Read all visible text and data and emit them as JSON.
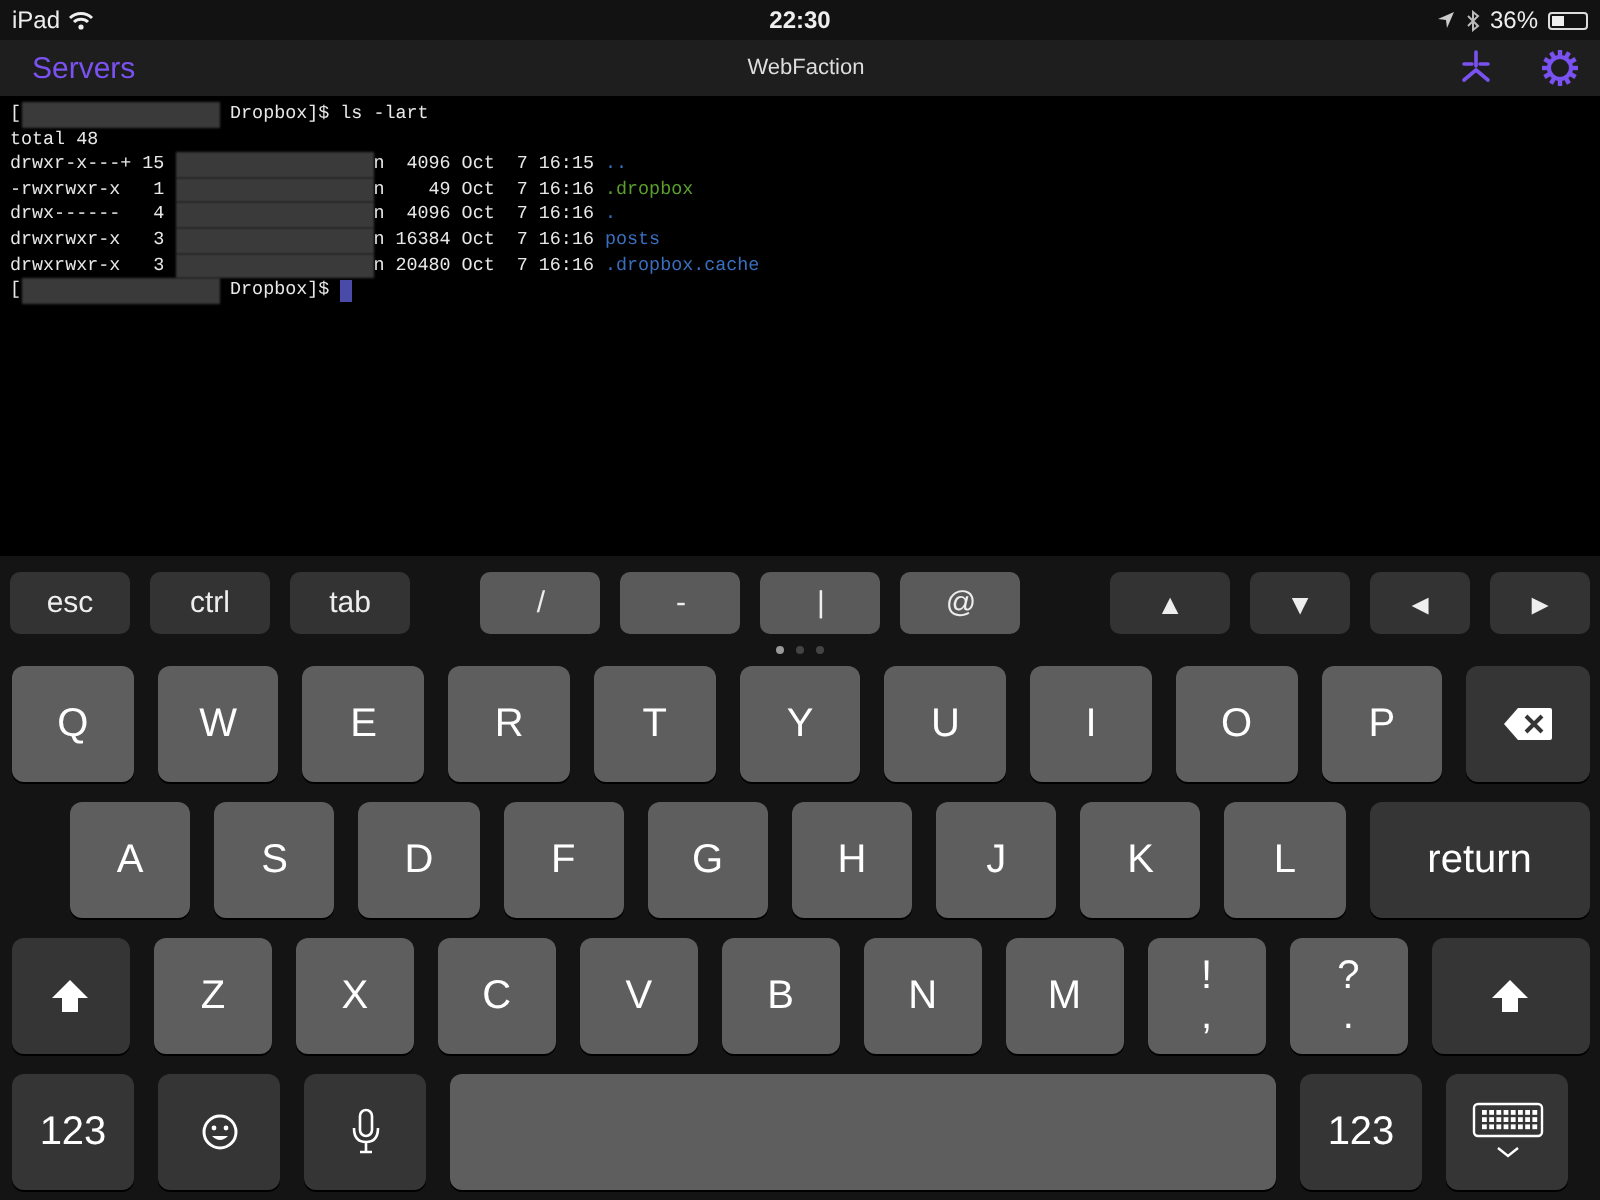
{
  "status_bar": {
    "carrier": "iPad",
    "time": "22:30",
    "battery": "36%"
  },
  "nav": {
    "back": "Servers",
    "title": "WebFaction"
  },
  "terminal": {
    "lines": [
      [
        {
          "kind": "text",
          "text": "["
        },
        {
          "kind": "redacted"
        },
        {
          "kind": "text",
          "text": " Dropbox]$ ls -lart"
        }
      ],
      [
        {
          "kind": "text",
          "text": "total 48"
        }
      ],
      [
        {
          "kind": "text",
          "text": "drwxr-x---+ 15 "
        },
        {
          "kind": "redacted"
        },
        {
          "kind": "text",
          "text": "n  4096 Oct  7 16:15 "
        },
        {
          "kind": "dir",
          "text": ".."
        }
      ],
      [
        {
          "kind": "text",
          "text": "-rwxrwxr-x   1 "
        },
        {
          "kind": "redacted"
        },
        {
          "kind": "text",
          "text": "n    49 Oct  7 16:16 "
        },
        {
          "kind": "exec",
          "text": ".dropbox"
        }
      ],
      [
        {
          "kind": "text",
          "text": "drwx------   4 "
        },
        {
          "kind": "redacted"
        },
        {
          "kind": "text",
          "text": "n  4096 Oct  7 16:16 "
        },
        {
          "kind": "dir",
          "text": "."
        }
      ],
      [
        {
          "kind": "text",
          "text": "drwxrwxr-x   3 "
        },
        {
          "kind": "redacted"
        },
        {
          "kind": "text",
          "text": "n 16384 Oct  7 16:16 "
        },
        {
          "kind": "dir",
          "text": "posts"
        }
      ],
      [
        {
          "kind": "text",
          "text": "drwxrwxr-x   3 "
        },
        {
          "kind": "redacted"
        },
        {
          "kind": "text",
          "text": "n 20480 Oct  7 16:16 "
        },
        {
          "kind": "dir",
          "text": ".dropbox.cache"
        }
      ],
      [
        {
          "kind": "text",
          "text": "["
        },
        {
          "kind": "redacted"
        },
        {
          "kind": "text",
          "text": " Dropbox]$ "
        },
        {
          "kind": "cursor"
        }
      ]
    ]
  },
  "accessory_keys": {
    "modifiers": [
      {
        "label": "esc",
        "kind": "dark"
      },
      {
        "label": "ctrl",
        "kind": "dark"
      },
      {
        "label": "tab",
        "kind": "dark"
      }
    ],
    "symbols": [
      {
        "label": "/",
        "kind": "light"
      },
      {
        "label": "-",
        "kind": "light"
      },
      {
        "label": "|",
        "kind": "light"
      },
      {
        "label": "@",
        "kind": "light"
      }
    ],
    "arrows": [
      {
        "label": "▲",
        "kind": "dark"
      },
      {
        "label": "▼",
        "kind": "dark"
      },
      {
        "label": "◄",
        "kind": "dark"
      },
      {
        "label": "►",
        "kind": "dark"
      }
    ]
  },
  "page_dots": [
    {
      "selected": true
    },
    {
      "selected": false
    },
    {
      "selected": false
    }
  ],
  "keyboard_rows": [
    [
      {
        "kind": "letter",
        "label": "Q"
      },
      {
        "kind": "letter",
        "label": "W"
      },
      {
        "kind": "letter",
        "label": "E"
      },
      {
        "kind": "letter",
        "label": "R"
      },
      {
        "kind": "letter",
        "label": "T"
      },
      {
        "kind": "letter",
        "label": "Y"
      },
      {
        "kind": "letter",
        "label": "U"
      },
      {
        "kind": "letter",
        "label": "I"
      },
      {
        "kind": "letter",
        "label": "O"
      },
      {
        "kind": "letter",
        "label": "P"
      },
      {
        "kind": "backspace"
      }
    ],
    [
      {
        "kind": "letter",
        "label": "A"
      },
      {
        "kind": "letter",
        "label": "S"
      },
      {
        "kind": "letter",
        "label": "D"
      },
      {
        "kind": "letter",
        "label": "F"
      },
      {
        "kind": "letter",
        "label": "G"
      },
      {
        "kind": "letter",
        "label": "H"
      },
      {
        "kind": "letter",
        "label": "J"
      },
      {
        "kind": "letter",
        "label": "K"
      },
      {
        "kind": "letter",
        "label": "L"
      },
      {
        "kind": "return",
        "label": "return"
      }
    ],
    [
      {
        "kind": "shift"
      },
      {
        "kind": "letter",
        "label": "Z"
      },
      {
        "kind": "letter",
        "label": "X"
      },
      {
        "kind": "letter",
        "label": "C"
      },
      {
        "kind": "letter",
        "label": "V"
      },
      {
        "kind": "letter",
        "label": "B"
      },
      {
        "kind": "letter",
        "label": "N"
      },
      {
        "kind": "letter",
        "label": "M"
      },
      {
        "kind": "punct",
        "top": "!",
        "bottom": ","
      },
      {
        "kind": "punct",
        "top": "?",
        "bottom": "."
      },
      {
        "kind": "shift_wide"
      }
    ],
    [
      {
        "kind": "numbers",
        "label": "123"
      },
      {
        "kind": "emoji"
      },
      {
        "kind": "mic"
      },
      {
        "kind": "space"
      },
      {
        "kind": "numbers",
        "label": "123"
      },
      {
        "kind": "hide"
      }
    ]
  ]
}
